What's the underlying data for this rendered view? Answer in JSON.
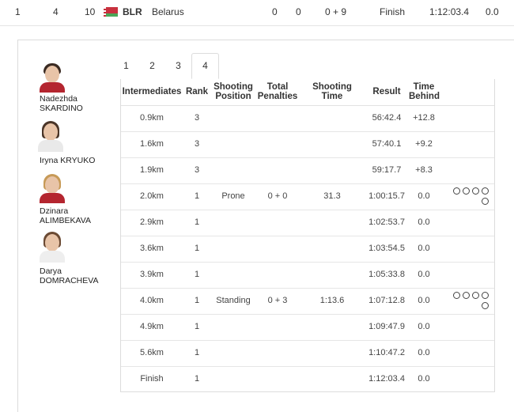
{
  "summary": {
    "rank": "1",
    "bib": "4",
    "num": "10",
    "noc": "BLR",
    "country": "Belarus",
    "penalties_a": "0",
    "penalties_b": "0",
    "shooting": "0 + 9",
    "status": "Finish",
    "time": "1:12:03.4",
    "behind": "0.0"
  },
  "athletes": [
    {
      "name": "Nadezhda\nSKARDINO"
    },
    {
      "name": "Iryna KRYUKO"
    },
    {
      "name": "Dzinara\nALIMBEKAVA"
    },
    {
      "name": "Darya\nDOMRACHEVA"
    }
  ],
  "tabs": [
    "1",
    "2",
    "3",
    "4"
  ],
  "active_tab": "4",
  "table": {
    "headers": {
      "intermediates": "Intermediates",
      "rank": "Rank",
      "shooting_position": "Shooting\nPosition",
      "total_penalties": "Total\nPenalties",
      "shooting_time": "Shooting\nTime",
      "result": "Result",
      "time_behind": "Time\nBehind"
    },
    "rows": [
      {
        "inter": "0.9km",
        "rank": "3",
        "pos": "",
        "pen": "",
        "stime": "",
        "result": "56:42.4",
        "behind": "+12.8"
      },
      {
        "inter": "1.6km",
        "rank": "3",
        "pos": "",
        "pen": "",
        "stime": "",
        "result": "57:40.1",
        "behind": "+9.2"
      },
      {
        "inter": "1.9km",
        "rank": "3",
        "pos": "",
        "pen": "",
        "stime": "",
        "result": "59:17.7",
        "behind": "+8.3"
      },
      {
        "inter": "2.0km",
        "rank": "1",
        "pos": "Prone",
        "pen": "0 + 0",
        "stime": "31.3",
        "result": "1:00:15.7",
        "behind": "0.0"
      },
      {
        "inter": "2.9km",
        "rank": "1",
        "pos": "",
        "pen": "",
        "stime": "",
        "result": "1:02:53.7",
        "behind": "0.0"
      },
      {
        "inter": "3.6km",
        "rank": "1",
        "pos": "",
        "pen": "",
        "stime": "",
        "result": "1:03:54.5",
        "behind": "0.0"
      },
      {
        "inter": "3.9km",
        "rank": "1",
        "pos": "",
        "pen": "",
        "stime": "",
        "result": "1:05:33.8",
        "behind": "0.0"
      },
      {
        "inter": "4.0km",
        "rank": "1",
        "pos": "Standing",
        "pen": "0 + 3",
        "stime": "1:13.6",
        "result": "1:07:12.8",
        "behind": "0.0"
      },
      {
        "inter": "4.9km",
        "rank": "1",
        "pos": "",
        "pen": "",
        "stime": "",
        "result": "1:09:47.9",
        "behind": "0.0"
      },
      {
        "inter": "5.6km",
        "rank": "1",
        "pos": "",
        "pen": "",
        "stime": "",
        "result": "1:10:47.2",
        "behind": "0.0"
      },
      {
        "inter": "Finish",
        "rank": "1",
        "pos": "",
        "pen": "",
        "stime": "",
        "result": "1:12:03.4",
        "behind": "0.0"
      }
    ],
    "shot_targets": [
      {
        "row": 3,
        "count": 5
      },
      {
        "row": 7,
        "count": 5
      }
    ]
  },
  "colors": {
    "flag_red": "#c8313e",
    "flag_green": "#4aa657",
    "athlete_jersey": "#b4252f"
  },
  "icons": [
    "flag-icon-belarus",
    "athlete-photo",
    "shot-target-icon"
  ]
}
